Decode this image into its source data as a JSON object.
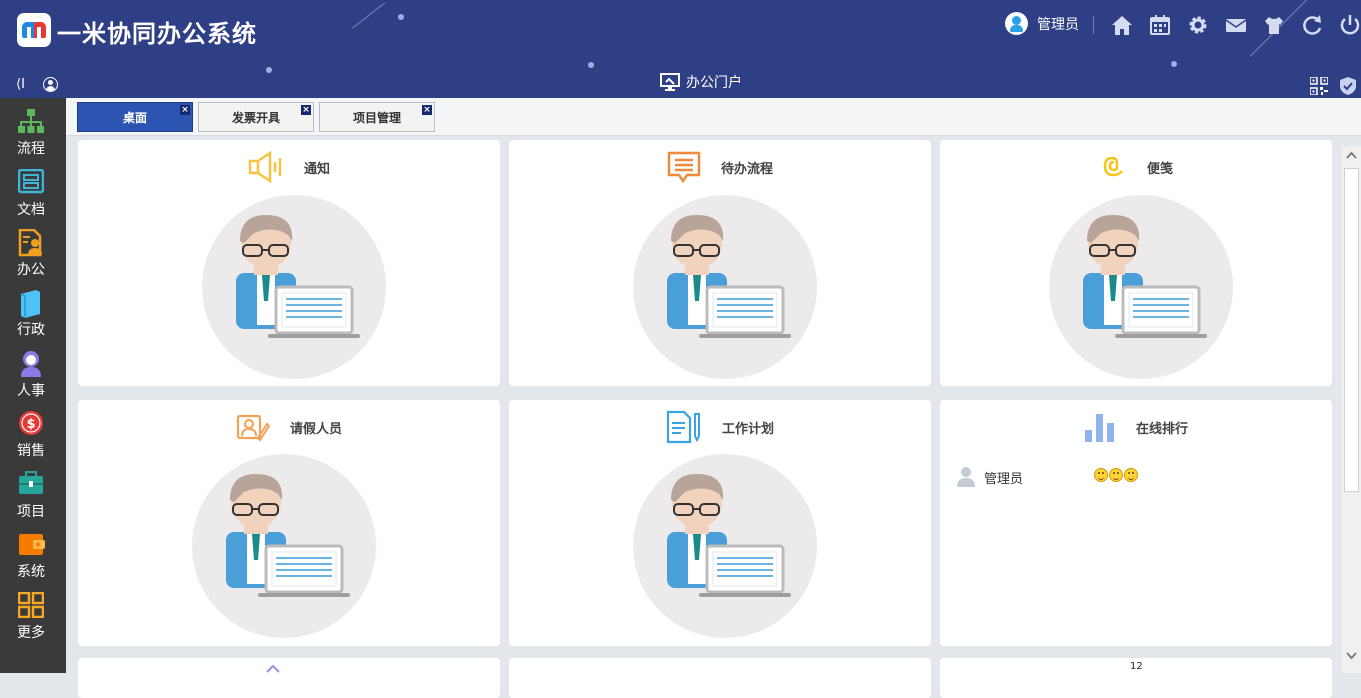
{
  "app": {
    "title": "一米协同办公系统"
  },
  "header": {
    "user_name": "管理员",
    "icons": [
      "home-icon",
      "calendar-icon",
      "gear-icon",
      "mail-icon",
      "shirt-icon",
      "refresh-icon",
      "power-icon"
    ],
    "collapse_label": "⟨I",
    "portal_label": "办公门户",
    "colors": {
      "header_bg": "#2e3f85",
      "accent": "#2b55b0"
    }
  },
  "sidebar": {
    "items": [
      {
        "label": "流程",
        "icon": "flow-icon",
        "color": "#5cb85c"
      },
      {
        "label": "文档",
        "icon": "document-icon",
        "color": "#3fb6d8"
      },
      {
        "label": "办公",
        "icon": "office-icon",
        "color": "#f0a020"
      },
      {
        "label": "行政",
        "icon": "book-icon",
        "color": "#4fc3f7"
      },
      {
        "label": "人事",
        "icon": "person-icon",
        "color": "#8c7ae6"
      },
      {
        "label": "销售",
        "icon": "dollar-icon",
        "color": "#e53935"
      },
      {
        "label": "项目",
        "icon": "briefcase-icon",
        "color": "#26a69a"
      },
      {
        "label": "系统",
        "icon": "wallet-icon",
        "color": "#f57c00"
      },
      {
        "label": "更多",
        "icon": "grid-icon",
        "color": "#f9a825"
      }
    ]
  },
  "tabs": [
    {
      "label": "桌面",
      "active": true,
      "close": "×"
    },
    {
      "label": "发票开具",
      "active": false,
      "close": "×"
    },
    {
      "label": "项目管理",
      "active": false,
      "close": "×"
    }
  ],
  "cards": [
    {
      "title": "通知",
      "icon": "speaker-icon"
    },
    {
      "title": "待办流程",
      "icon": "message-list-icon"
    },
    {
      "title": "便笺",
      "icon": "note-icon"
    },
    {
      "title": "请假人员",
      "icon": "leave-person-icon"
    },
    {
      "title": "工作计划",
      "icon": "plan-document-icon"
    },
    {
      "title": "在线排行",
      "icon": "bar-chart-icon"
    }
  ],
  "online_rank": {
    "rows": [
      {
        "name": "管理员",
        "level_icons": 3
      }
    ]
  },
  "badge_text": "12"
}
